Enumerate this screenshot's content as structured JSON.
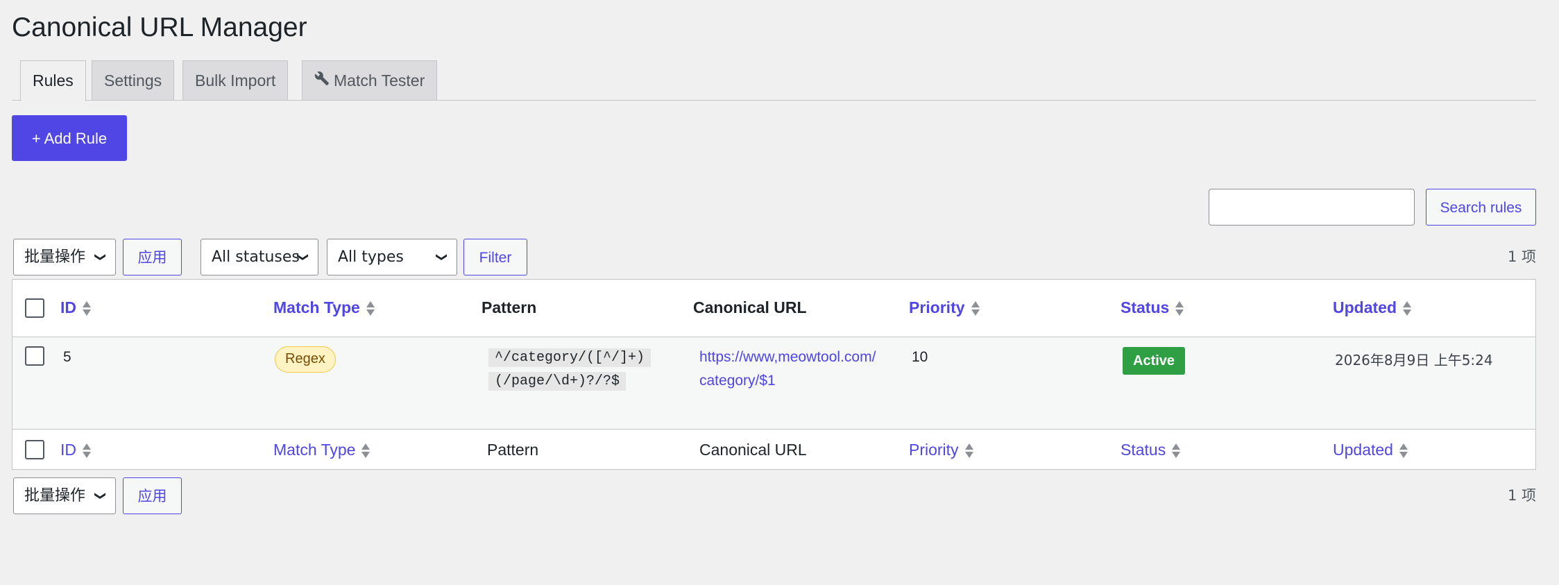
{
  "page": {
    "title": "Canonical URL Manager"
  },
  "tabs": [
    {
      "label": "Rules",
      "active": true
    },
    {
      "label": "Settings",
      "active": false
    },
    {
      "label": "Bulk Import",
      "active": false
    },
    {
      "label": "Match Tester",
      "icon": "wrench-icon",
      "active": false
    }
  ],
  "toolbar": {
    "add_rule_label": "+ Add Rule",
    "search_button": "Search rules",
    "search_value": "",
    "bulk_actions": "批量操作",
    "apply": "应用",
    "status_filter": "All statuses",
    "type_filter": "All types",
    "filter_button": "Filter",
    "item_count": "1 项"
  },
  "table": {
    "columns": [
      "ID",
      "Match Type",
      "Pattern",
      "Canonical URL",
      "Priority",
      "Status",
      "Updated"
    ],
    "sortable": [
      true,
      true,
      false,
      false,
      true,
      true,
      true
    ],
    "rows": [
      {
        "id": "5",
        "match_type": "Regex",
        "pattern_line1": "^/category/([^/]+)",
        "pattern_line2": "(/page/\\d+)?/?$",
        "canonical_line1": "https://www,meowtool.com/",
        "canonical_line2": "category/$1",
        "priority": "10",
        "status": "Active",
        "updated": "2026年8月9日 上午5:24"
      }
    ]
  },
  "colors": {
    "accent": "#4f46e5",
    "active_badge": "#2ea043",
    "regex_badge_bg": "#fff3c4",
    "background": "#f0f0f1"
  }
}
